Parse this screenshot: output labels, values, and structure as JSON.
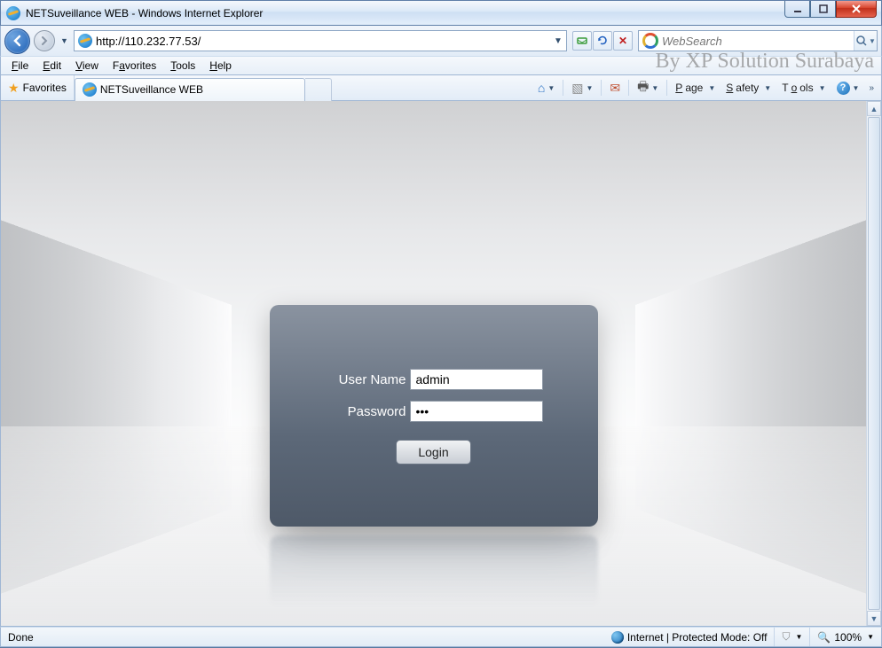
{
  "window": {
    "title": "NETSuveillance WEB - Windows Internet Explorer"
  },
  "address": {
    "url": "http://110.232.77.53/"
  },
  "search": {
    "placeholder": "WebSearch"
  },
  "menu": {
    "file": "File",
    "edit": "Edit",
    "view": "View",
    "favorites": "Favorites",
    "tools": "Tools",
    "help": "Help"
  },
  "watermark": "By XP Solution Surabaya",
  "favbar": {
    "favorites": "Favorites"
  },
  "tab": {
    "title": "NETSuveillance WEB"
  },
  "commands": {
    "page": "Page",
    "safety": "Safety",
    "tools": "Tools"
  },
  "login": {
    "username_label": "User Name",
    "password_label": "Password",
    "username_value": "admin",
    "password_value": "•••",
    "button": "Login"
  },
  "status": {
    "done": "Done",
    "zone": "Internet | Protected Mode: Off",
    "zoom": "100%"
  }
}
